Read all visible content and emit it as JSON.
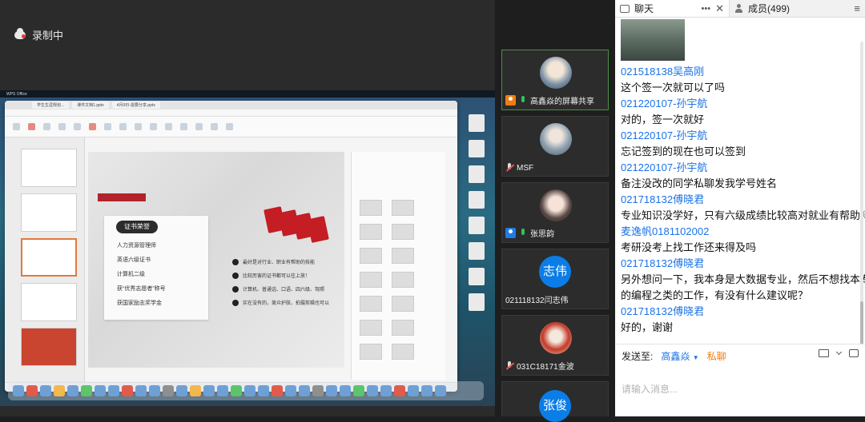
{
  "recording": {
    "label": "录制中"
  },
  "shared_screen": {
    "app_name": "WPS Office",
    "file_tabs": [
      "学生生涯规划...",
      "课件文档1.pptx",
      "4月9日-需要分享.pptx"
    ],
    "slide_title": "证书荣誉",
    "certificates": [
      "人力资源管理师",
      "英语六级证书",
      "计算机二级",
      "获“优秀志愿者”称号",
      "获国家励志奖学金"
    ],
    "tips": [
      "最好是对行业、职业有帮助的技能",
      "比较厉害的证书都可以往上放！",
      "计算机、普通话、口语、四六级、驾照",
      "实在没有的，美众护肤、拍摄剪辑也可以"
    ]
  },
  "videos": [
    {
      "name": "高鑫焱的屏幕共享",
      "avatar": "photo",
      "active": true,
      "mic": "on",
      "badge": "share"
    },
    {
      "name": "MSF",
      "avatar": "photo",
      "active": false,
      "mic": "off",
      "badge": "none"
    },
    {
      "name": "张思韵",
      "avatar": "photo",
      "active": false,
      "mic": "on",
      "badge": "user"
    },
    {
      "name": "021118132闫志伟",
      "avatar": "circle",
      "circle_text": "志伟",
      "active": false,
      "mic": "none",
      "badge": "none"
    },
    {
      "name": "031C18171金波",
      "avatar": "photo",
      "active": false,
      "mic": "off",
      "badge": "none"
    },
    {
      "name": "",
      "avatar": "circle",
      "circle_text": "张俊",
      "active": false,
      "mic": "none",
      "badge": "none"
    }
  ],
  "chat": {
    "tab_chat": "聊天",
    "tab_members": "成员(499)",
    "messages": [
      {
        "sender": "021518138吴高刚",
        "text": "这个签一次就可以了吗"
      },
      {
        "sender": "021220107-孙宇航",
        "text": "对的，签一次就好"
      },
      {
        "sender": "021220107-孙宇航",
        "text": "忘记签到的现在也可以签到"
      },
      {
        "sender": "021220107-孙宇航",
        "text": "备注没改的同学私聊发我学号姓名"
      },
      {
        "sender": "021718132傅晓君",
        "text": "专业知识没学好，只有六级成绩比较高对就业有帮助吗？"
      },
      {
        "sender": "麦逸帆0181102002",
        "text": "考研没考上找工作还来得及吗"
      },
      {
        "sender": "021718132傅晓君",
        "text": "另外想问一下，我本身是大数据专业，然后不想找本专业"
      },
      {
        "sender": "",
        "text": "的编程之类的工作，有没有什么建议呢？"
      },
      {
        "sender": "021718132傅晓君",
        "text": "好的，谢谢"
      }
    ],
    "send_to_label": "发送至:",
    "send_to_target": "高鑫焱",
    "send_mode": "私聊",
    "input_placeholder": "请输入消息..."
  }
}
